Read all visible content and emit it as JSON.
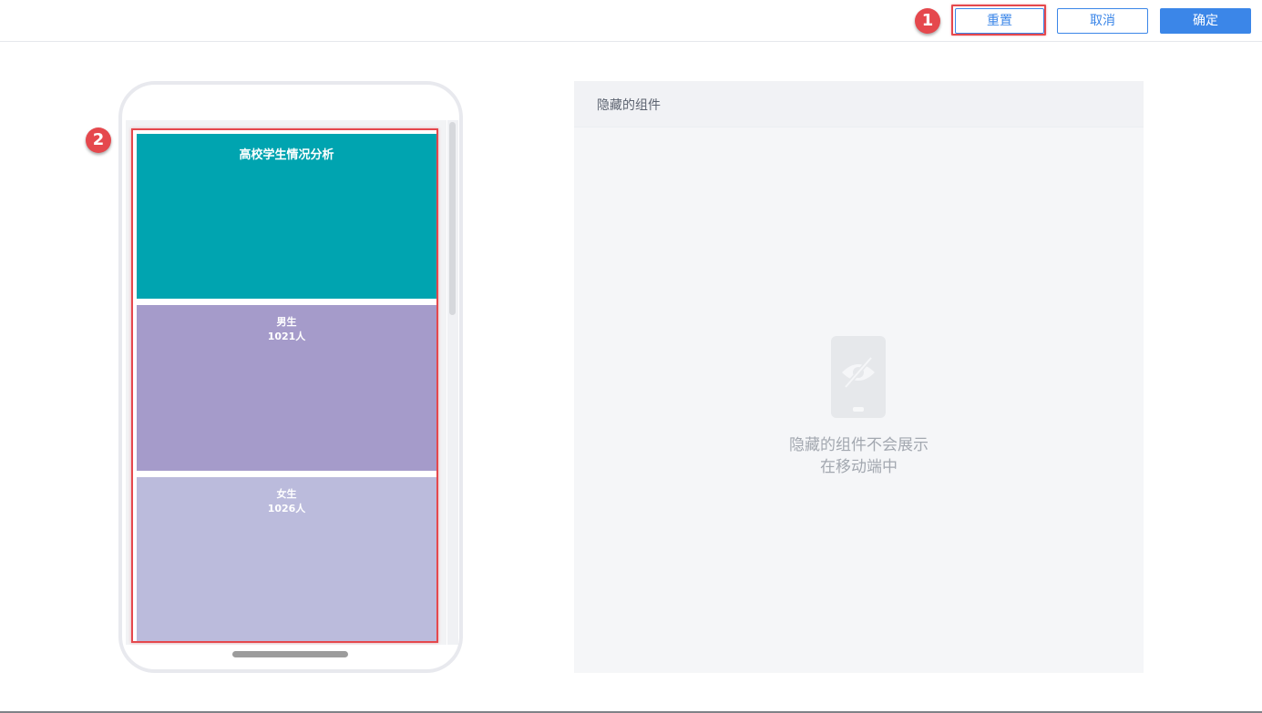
{
  "toolbar": {
    "reset_label": "重置",
    "cancel_label": "取消",
    "confirm_label": "确定"
  },
  "markers": {
    "one": "1",
    "two": "2"
  },
  "preview": {
    "title": "高校学生情况分析",
    "male": {
      "label": "男生",
      "value": "1021人"
    },
    "female": {
      "label": "女生",
      "value": "1026人"
    }
  },
  "hidden_panel": {
    "title": "隐藏的组件",
    "empty_line1": "隐藏的组件不会展示",
    "empty_line2": "在移动端中",
    "icon": "hidden-phone-icon"
  },
  "colors": {
    "accent": "#3b86e8",
    "highlight": "#e5484d",
    "title_block": "#00a4b0",
    "male_block": "#a59bca",
    "female_block": "#bbbbdc"
  }
}
